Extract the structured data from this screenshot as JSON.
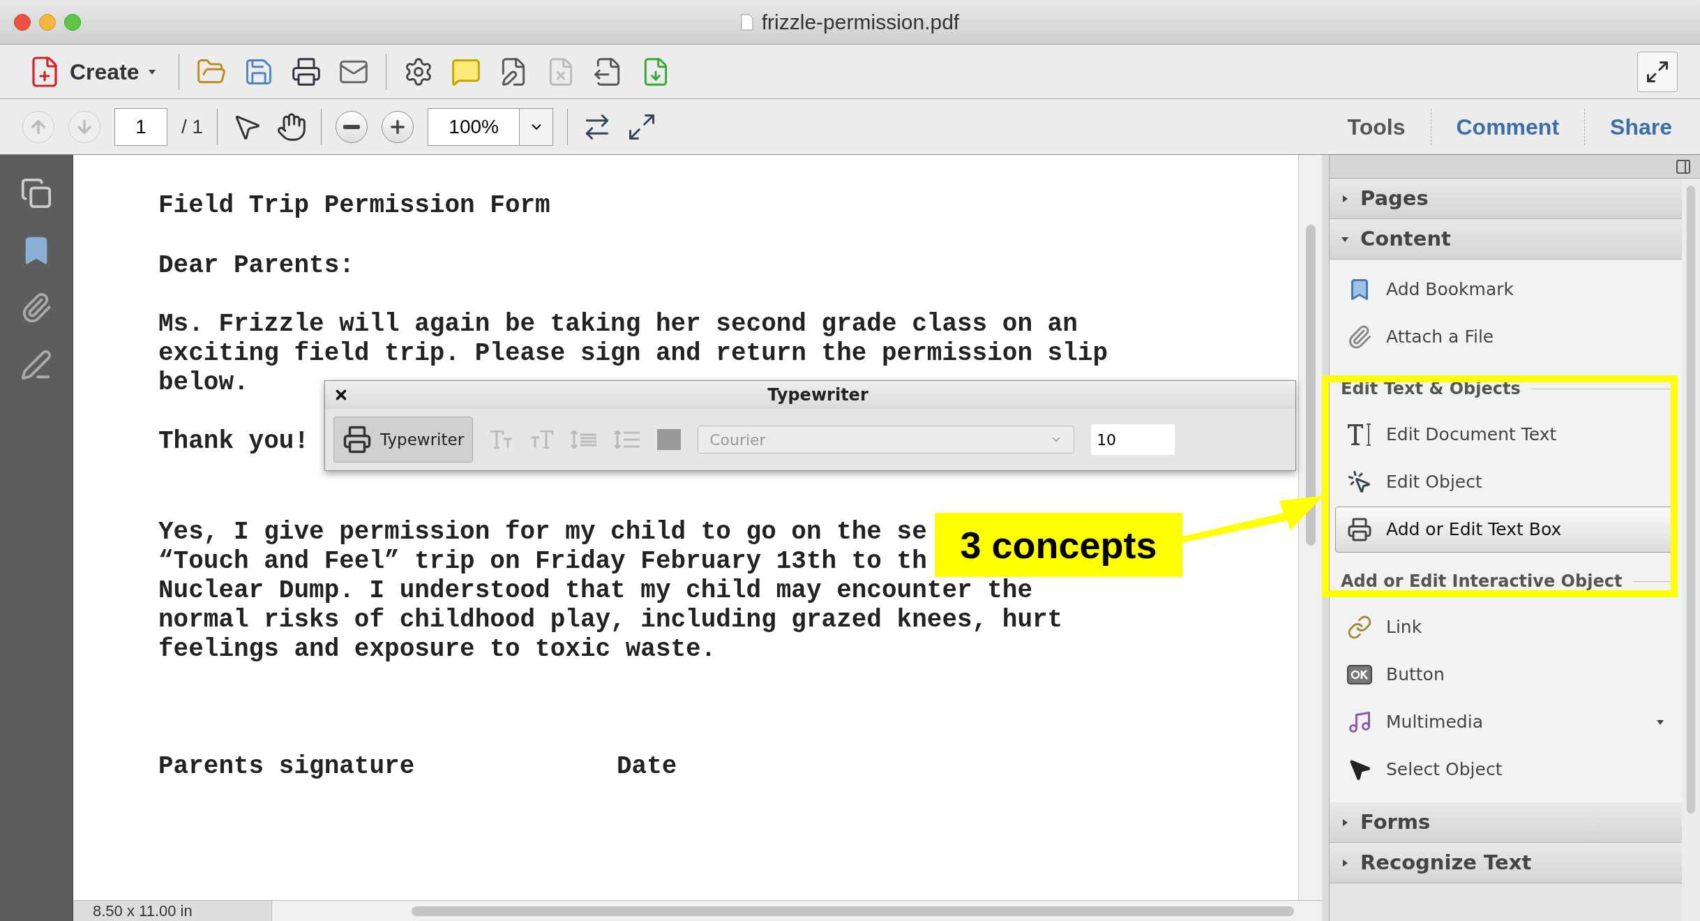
{
  "window": {
    "title": "frizzle-permission.pdf"
  },
  "toolbar": {
    "create_label": "Create"
  },
  "nav": {
    "page": "1",
    "page_total": "/ 1",
    "zoom": "100%"
  },
  "tabs": [
    {
      "label": "Tools",
      "selected": true
    },
    {
      "label": "Comment",
      "selected": false
    },
    {
      "label": "Share",
      "selected": false
    }
  ],
  "document": {
    "paragraphs": [
      [
        "Field Trip Permission Form"
      ],
      [
        "Dear Parents:"
      ],
      [
        "Ms. Frizzle will again be taking her second grade class on an",
        "exciting field trip. Please sign and return the permission slip",
        "below."
      ],
      [
        "Thank you!"
      ],
      [
        "Yes, I give permission for my child to go on the se",
        "“Touch and Feel” trip on Friday February 13th to th",
        "Nuclear Dump. I understood that my child may encounter the",
        "normal risks of childhood play, including grazed knees, hurt",
        "feelings and exposure to toxic waste."
      ]
    ],
    "signature_label": "Parents signature",
    "date_label": "Date"
  },
  "status_bar": {
    "page_size": "8.50 x 11.00 in"
  },
  "typewriter_toolbar": {
    "title": "Typewriter",
    "tool_label": "Typewriter",
    "tool_selected": true,
    "font": "Courier",
    "font_disabled": true,
    "size": "10"
  },
  "panel": {
    "sections": [
      {
        "title": "Pages",
        "expanded": false
      },
      {
        "title": "Content",
        "expanded": true,
        "groups": [
          {
            "items": [
              {
                "label": "Add Bookmark",
                "selected": false
              },
              {
                "label": "Attach a File",
                "selected": false
              }
            ]
          },
          {
            "heading": "Edit Text & Objects",
            "items": [
              {
                "label": "Edit Document Text",
                "selected": false
              },
              {
                "label": "Edit Object",
                "selected": false
              },
              {
                "label": "Add or Edit Text Box",
                "selected": true
              }
            ]
          },
          {
            "heading": "Add or Edit Interactive Object",
            "items": [
              {
                "label": "Link",
                "selected": false
              },
              {
                "label": "Button",
                "selected": false
              },
              {
                "label": "Multimedia",
                "selected": false,
                "has_menu": true
              },
              {
                "label": "Select Object",
                "selected": false
              }
            ]
          }
        ]
      },
      {
        "title": "Forms",
        "expanded": false
      },
      {
        "title": "Recognize Text",
        "expanded": false
      }
    ]
  },
  "annotation": {
    "label": "3 concepts"
  }
}
